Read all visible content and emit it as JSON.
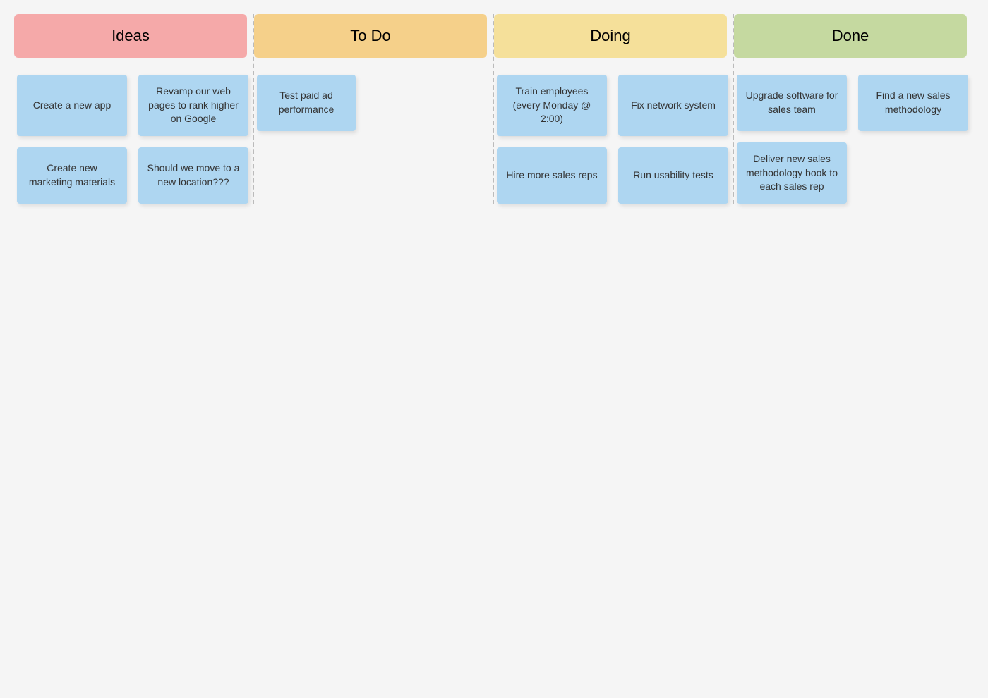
{
  "columns": [
    {
      "id": "ideas",
      "label": "Ideas",
      "colorClass": "column-ideas",
      "cards": [
        {
          "id": "ideas-1",
          "text": "Create a new app"
        },
        {
          "id": "ideas-2",
          "text": "Revamp our web pages to rank higher on Google"
        },
        {
          "id": "ideas-3",
          "text": "Create new marketing materials"
        },
        {
          "id": "ideas-4",
          "text": "Should we move to a new location???"
        }
      ]
    },
    {
      "id": "todo",
      "label": "To Do",
      "colorClass": "column-todo",
      "cards": [
        {
          "id": "todo-1",
          "text": "Test paid ad performance"
        }
      ]
    },
    {
      "id": "doing",
      "label": "Doing",
      "colorClass": "column-doing",
      "cards": [
        {
          "id": "doing-1",
          "text": "Train employees (every Monday @ 2:00)"
        },
        {
          "id": "doing-2",
          "text": "Fix network system"
        },
        {
          "id": "doing-3",
          "text": "Hire more sales reps"
        },
        {
          "id": "doing-4",
          "text": "Run usability tests"
        }
      ]
    },
    {
      "id": "done",
      "label": "Done",
      "colorClass": "column-done",
      "cards": [
        {
          "id": "done-1",
          "text": "Upgrade software for sales team"
        },
        {
          "id": "done-2",
          "text": "Find a new sales methodology"
        },
        {
          "id": "done-3",
          "text": "Deliver new sales methodology book to each sales rep"
        }
      ]
    }
  ]
}
